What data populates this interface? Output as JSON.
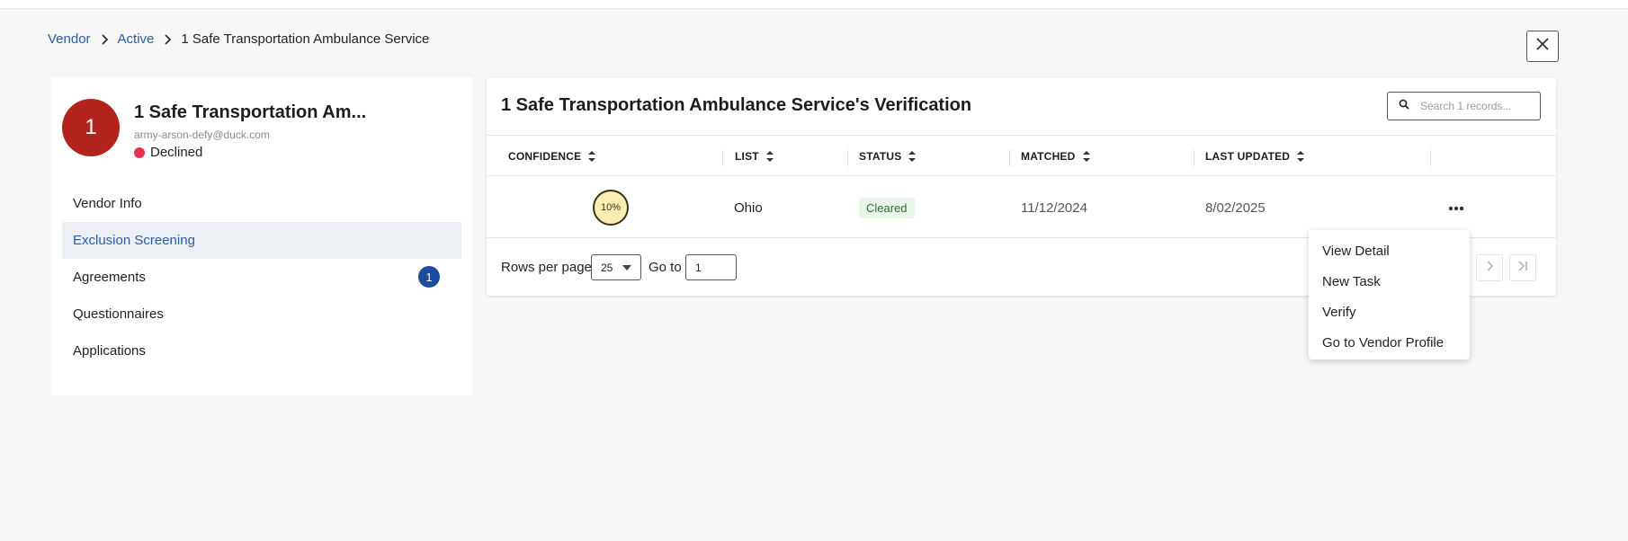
{
  "breadcrumb": {
    "items": [
      "Vendor",
      "Active"
    ],
    "current": "1 Safe Transportation Ambulance Service",
    "separator_icon": "chevron-right-icon"
  },
  "close_icon": "close-icon",
  "vendor": {
    "avatar_text": "1",
    "avatar_color": "#b1231c",
    "name": "1 Safe Transportation Am...",
    "email": "army-arson-defy@duck.com",
    "status": "Declined",
    "status_color": "#e6334f"
  },
  "nav": {
    "items": [
      {
        "label": "Vendor Info"
      },
      {
        "label": "Exclusion Screening",
        "active": true
      },
      {
        "label": "Agreements",
        "badge": "1"
      },
      {
        "label": "Questionnaires"
      },
      {
        "label": "Applications"
      }
    ]
  },
  "card": {
    "title": "1 Safe Transportation Ambulance Service's Verification",
    "search_placeholder": "Search 1 records..."
  },
  "table": {
    "columns": [
      "CONFIDENCE",
      "LIST",
      "STATUS",
      "MATCHED",
      "LAST UPDATED"
    ],
    "rows": [
      {
        "confidence": "10%",
        "list": "Ohio",
        "status": "Cleared",
        "matched": "11/12/2024",
        "last_updated": "8/02/2025"
      }
    ]
  },
  "pagination": {
    "rows_per_page_label": "Rows per page",
    "rows_per_page_value": "25",
    "goto_label": "Go to",
    "goto_value": "1"
  },
  "menu": {
    "items": [
      "View Detail",
      "New Task",
      "Verify",
      "Go to Vendor Profile"
    ]
  },
  "colors": {
    "accent": "#2a5aa8",
    "badge_blue": "#1c4c9a",
    "confidence_fill": "#fbeeb3",
    "cleared_bg": "#e8f5e9"
  }
}
